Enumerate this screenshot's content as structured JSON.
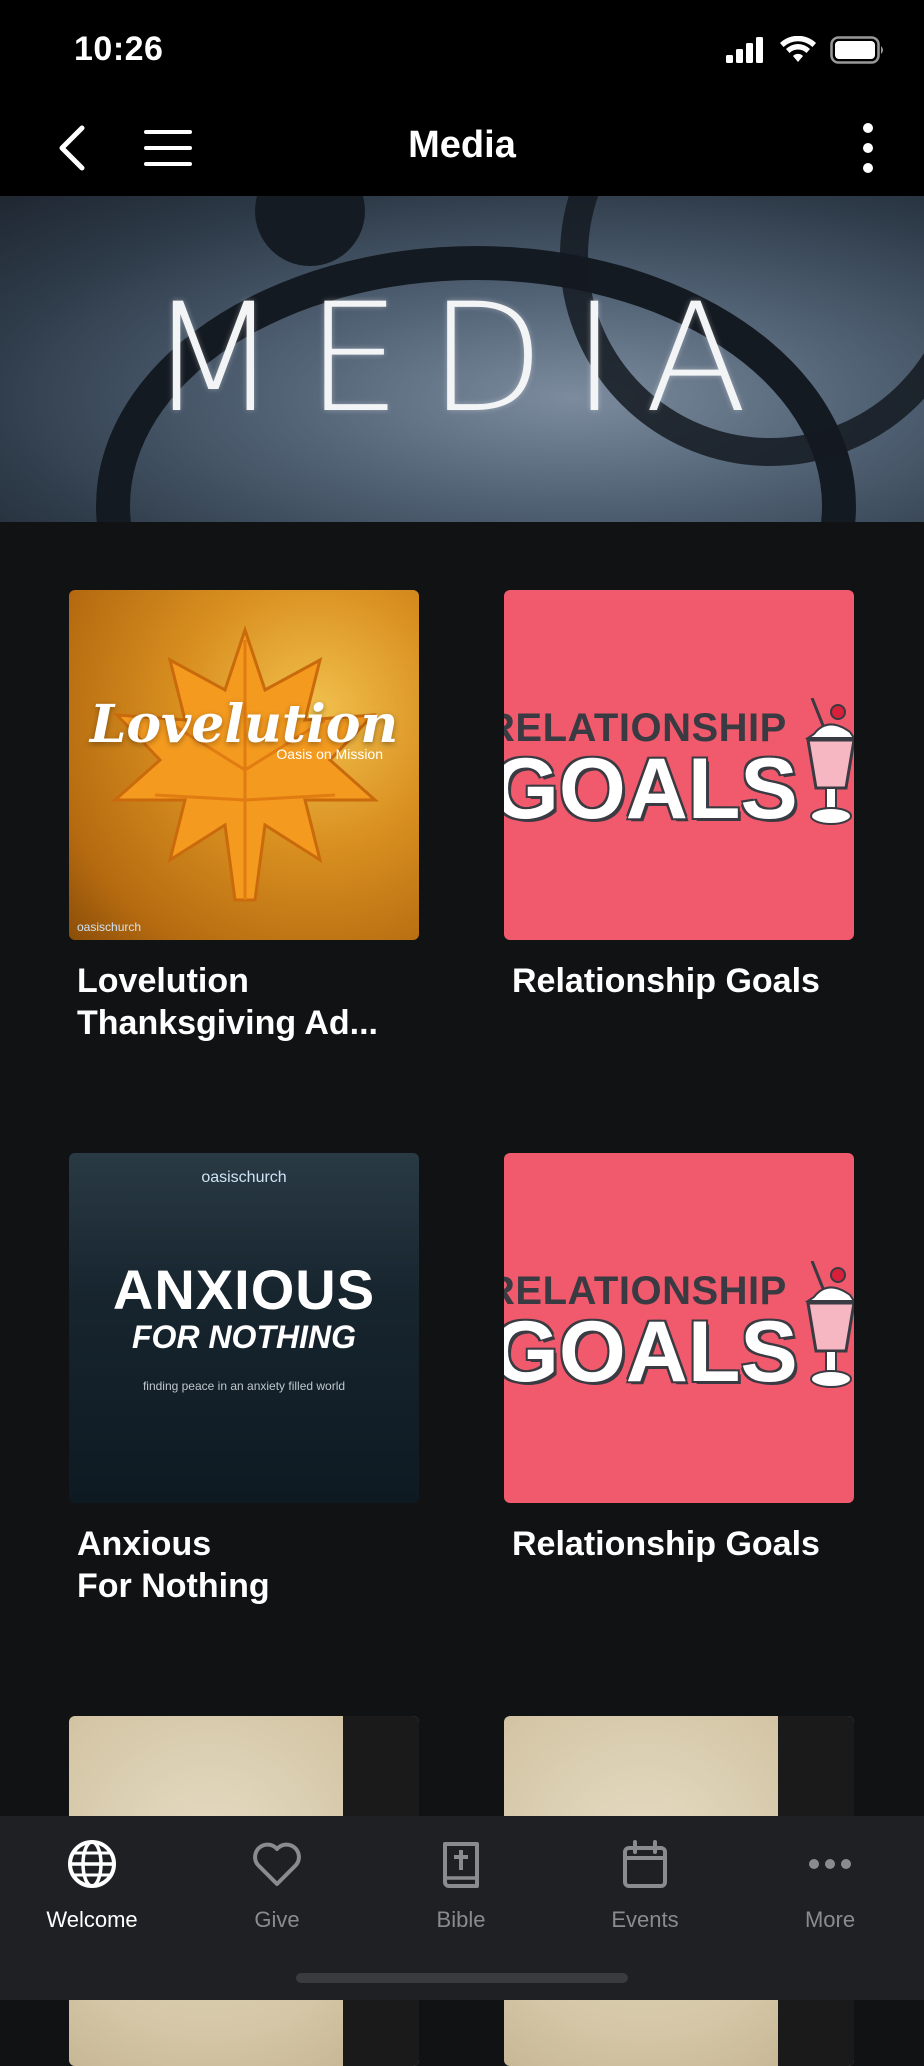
{
  "status_bar": {
    "time": "10:26"
  },
  "nav": {
    "title": "Media"
  },
  "hero": {
    "text": "MEDIA"
  },
  "items": [
    {
      "title": "Lovelution Thanksgiving Ad...",
      "title_line1": "Lovelution",
      "title_line2": "Thanksgiving Ad...",
      "art": {
        "big": "Lovelution",
        "sub": "Oasis on Mission",
        "brand": "oasischurch"
      }
    },
    {
      "title": "Relationship Goals",
      "art": {
        "line1": "RELATIONSHIP",
        "line2": "GOALS"
      }
    },
    {
      "title": "Anxious For Nothing",
      "title_line1": "Anxious",
      "title_line2": "For Nothing",
      "art": {
        "brand": "oasischurch",
        "big": "ANXIOUS",
        "mid": "FOR NOTHING",
        "tag": "finding peace in an anxiety filled world"
      }
    },
    {
      "title": "Relationship Goals",
      "art": {
        "line1": "RELATIONSHIP",
        "line2": "GOALS"
      }
    }
  ],
  "tabs": [
    {
      "label": "Welcome",
      "icon": "globe-icon",
      "active": true
    },
    {
      "label": "Give",
      "icon": "heart-icon",
      "active": false
    },
    {
      "label": "Bible",
      "icon": "bible-icon",
      "active": false
    },
    {
      "label": "Events",
      "icon": "calendar-icon",
      "active": false
    },
    {
      "label": "More",
      "icon": "more-icon",
      "active": false
    }
  ],
  "colors": {
    "background": "#111214",
    "tab_bar": "#1f2023",
    "inactive": "#8a8b8f",
    "goals_pink": "#f05a6c"
  }
}
